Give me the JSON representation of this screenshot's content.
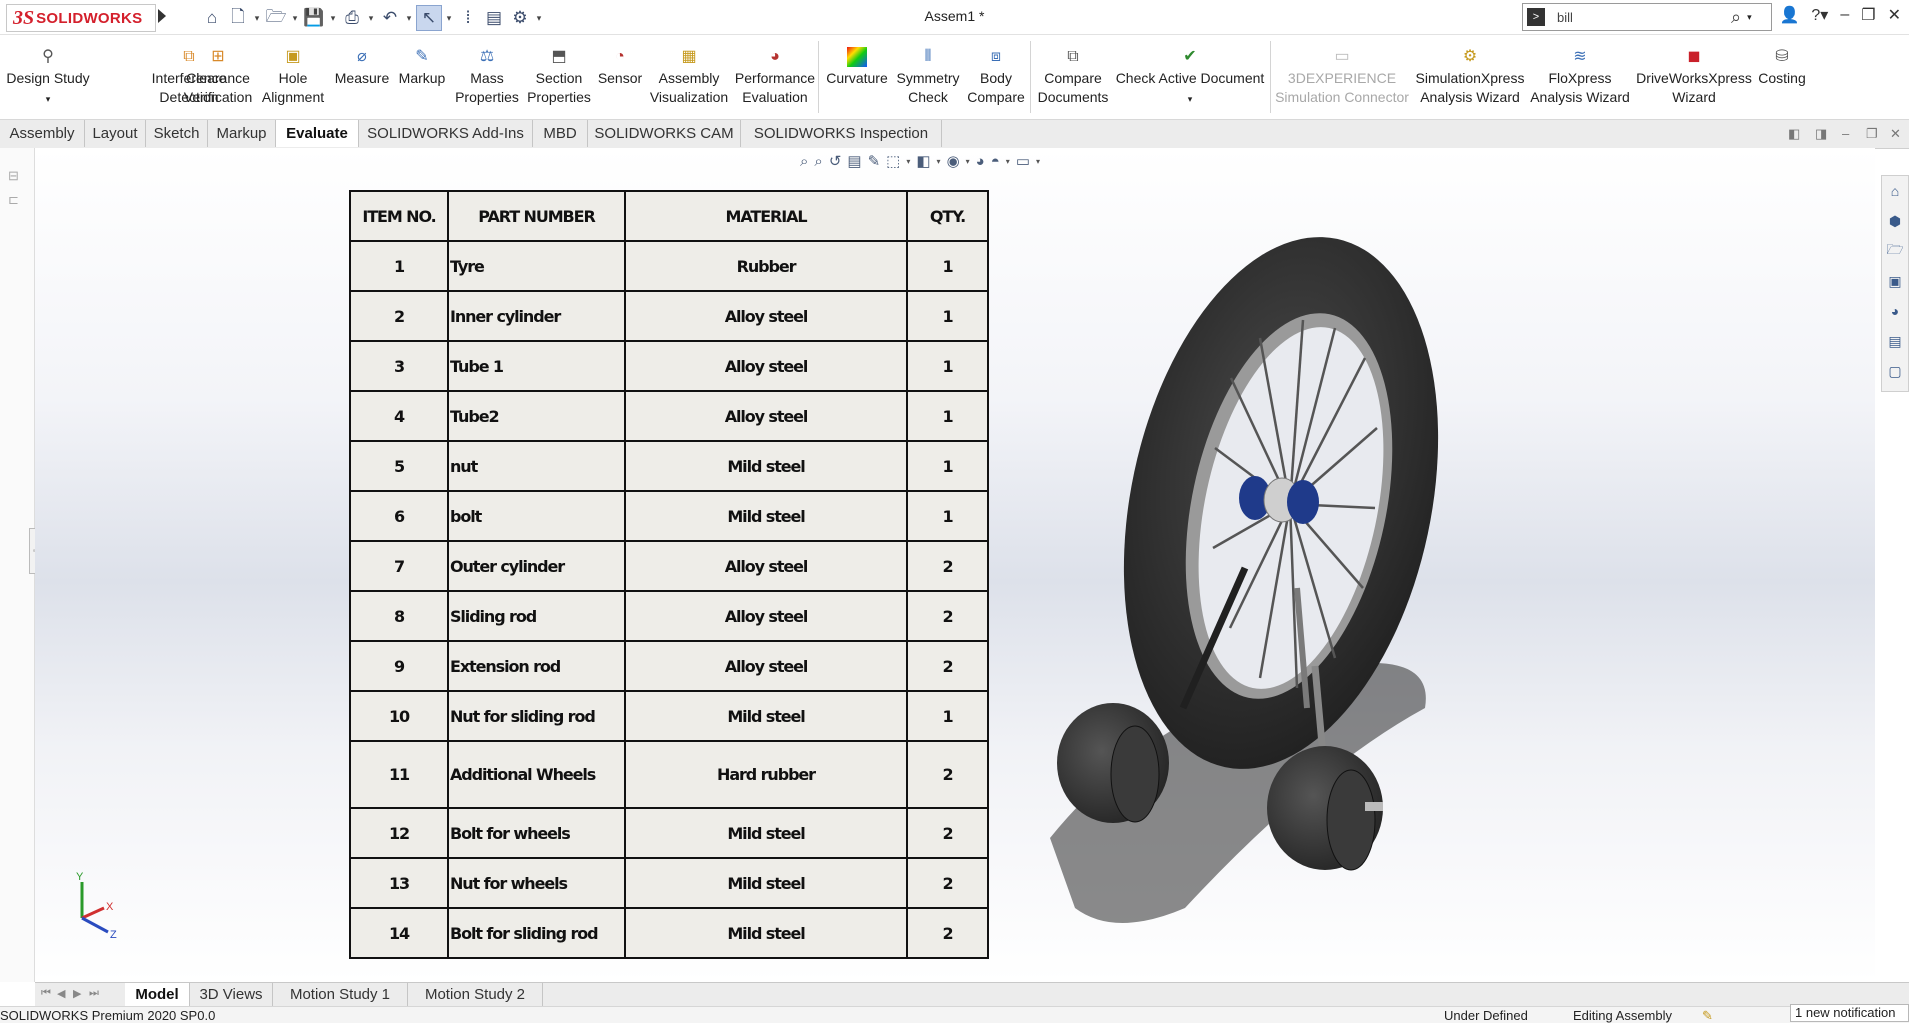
{
  "app": {
    "logo_ds": "3S",
    "logo_text": "SOLIDWORKS",
    "document_title": "Assem1 *",
    "search_value": "bill"
  },
  "ribbon": {
    "buttons": [
      {
        "label": "Design Study",
        "icon": "design-study-icon"
      },
      {
        "label": "Interference Detection",
        "icon": "interference-icon"
      },
      {
        "label": "Clearance Verification",
        "icon": "clearance-icon"
      },
      {
        "label": "Hole Alignment",
        "icon": "hole-alignment-icon"
      },
      {
        "label": "Measure",
        "icon": "measure-icon"
      },
      {
        "label": "Markup",
        "icon": "markup-icon"
      },
      {
        "label": "Mass Properties",
        "icon": "mass-properties-icon"
      },
      {
        "label": "Section Properties",
        "icon": "section-properties-icon"
      },
      {
        "label": "Sensor",
        "icon": "sensor-icon"
      },
      {
        "label": "Assembly Visualization",
        "icon": "assembly-visualization-icon"
      },
      {
        "label": "Performance Evaluation",
        "icon": "performance-icon"
      },
      {
        "label": "Curvature",
        "icon": "curvature-icon"
      },
      {
        "label": "Symmetry Check",
        "icon": "symmetry-icon"
      },
      {
        "label": "Body Compare",
        "icon": "body-compare-icon"
      },
      {
        "label": "Compare Documents",
        "icon": "compare-docs-icon"
      },
      {
        "label": "Check Active Document",
        "icon": "check-doc-icon"
      },
      {
        "label": "3DEXPERIENCE Simulation Connector",
        "icon": "3dx-icon"
      },
      {
        "label": "SimulationXpress Analysis Wizard",
        "icon": "simxpress-icon"
      },
      {
        "label": "FloXpress Analysis Wizard",
        "icon": "floxpress-icon"
      },
      {
        "label": "DriveWorksXpress Wizard",
        "icon": "driveworks-icon"
      },
      {
        "label": "Costing",
        "icon": "costing-icon"
      }
    ]
  },
  "tabs": [
    "Assembly",
    "Layout",
    "Sketch",
    "Markup",
    "Evaluate",
    "SOLIDWORKS Add-Ins",
    "MBD",
    "SOLIDWORKS CAM",
    "SOLIDWORKS Inspection"
  ],
  "active_tab": "Evaluate",
  "bom": {
    "headers": [
      "ITEM NO.",
      "PART NUMBER",
      "MATERIAL",
      "QTY."
    ],
    "rows": [
      [
        "1",
        "Tyre",
        "Rubber",
        "1"
      ],
      [
        "2",
        "Inner cylinder",
        "Alloy steel",
        "1"
      ],
      [
        "3",
        "Tube 1",
        "Alloy steel",
        "1"
      ],
      [
        "4",
        "Tube2",
        "Alloy steel",
        "1"
      ],
      [
        "5",
        "nut",
        "Mild steel",
        "1"
      ],
      [
        "6",
        "bolt",
        "Mild steel",
        "1"
      ],
      [
        "7",
        "Outer cylinder",
        "Alloy steel",
        "2"
      ],
      [
        "8",
        "Sliding rod",
        "Alloy steel",
        "2"
      ],
      [
        "9",
        "Extension rod",
        "Alloy steel",
        "2"
      ],
      [
        "10",
        "Nut for sliding rod",
        "Mild steel",
        "1"
      ],
      [
        "11",
        "Additional Wheels",
        "Hard rubber",
        "2"
      ],
      [
        "12",
        "Bolt for wheels",
        "Mild steel",
        "2"
      ],
      [
        "13",
        "Nut for wheels",
        "Mild steel",
        "2"
      ],
      [
        "14",
        "Bolt for sliding rod",
        "Mild steel",
        "2"
      ]
    ]
  },
  "triad": {
    "x": "X",
    "y": "Y",
    "z": "Z"
  },
  "bottom_tabs": [
    "Model",
    "3D Views",
    "Motion Study 1",
    "Motion Study 2"
  ],
  "active_bottom_tab": "Model",
  "status": {
    "product": "SOLIDWORKS Premium 2020 SP0.0",
    "definition": "Under Defined",
    "mode": "Editing Assembly",
    "notification": "1 new notification"
  },
  "colors": {
    "brand_red": "#d4202c",
    "tyre": "#2b2b2b",
    "hub_blue": "#1f3a8a",
    "table_bg": "#eeede8"
  }
}
